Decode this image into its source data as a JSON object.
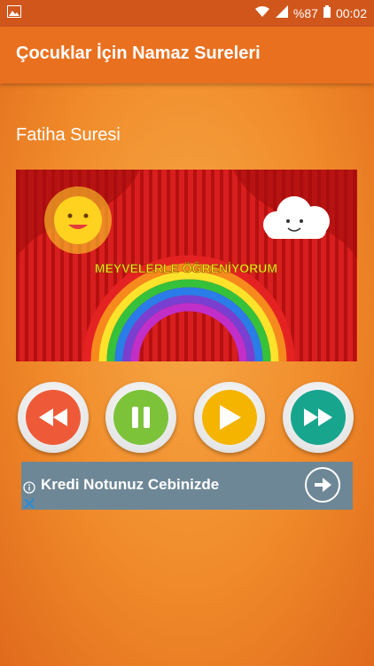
{
  "status_bar": {
    "battery": "%87",
    "time": "00:02"
  },
  "app_bar": {
    "title": "Çocuklar İçin Namaz Sureleri"
  },
  "section": {
    "title": "Fatiha Suresi"
  },
  "banner": {
    "caption": "MEYVELERLE ÖĞRENİYORUM"
  },
  "controls": [
    {
      "icon": "rewind-icon",
      "color": "#ee5a38"
    },
    {
      "icon": "pause-icon",
      "color": "#7cc33a"
    },
    {
      "icon": "play-icon",
      "color": "#f5b400"
    },
    {
      "icon": "fast-forward-icon",
      "color": "#18a58e"
    }
  ],
  "ad": {
    "text": "Kredi Notunuz Cebinizde"
  }
}
